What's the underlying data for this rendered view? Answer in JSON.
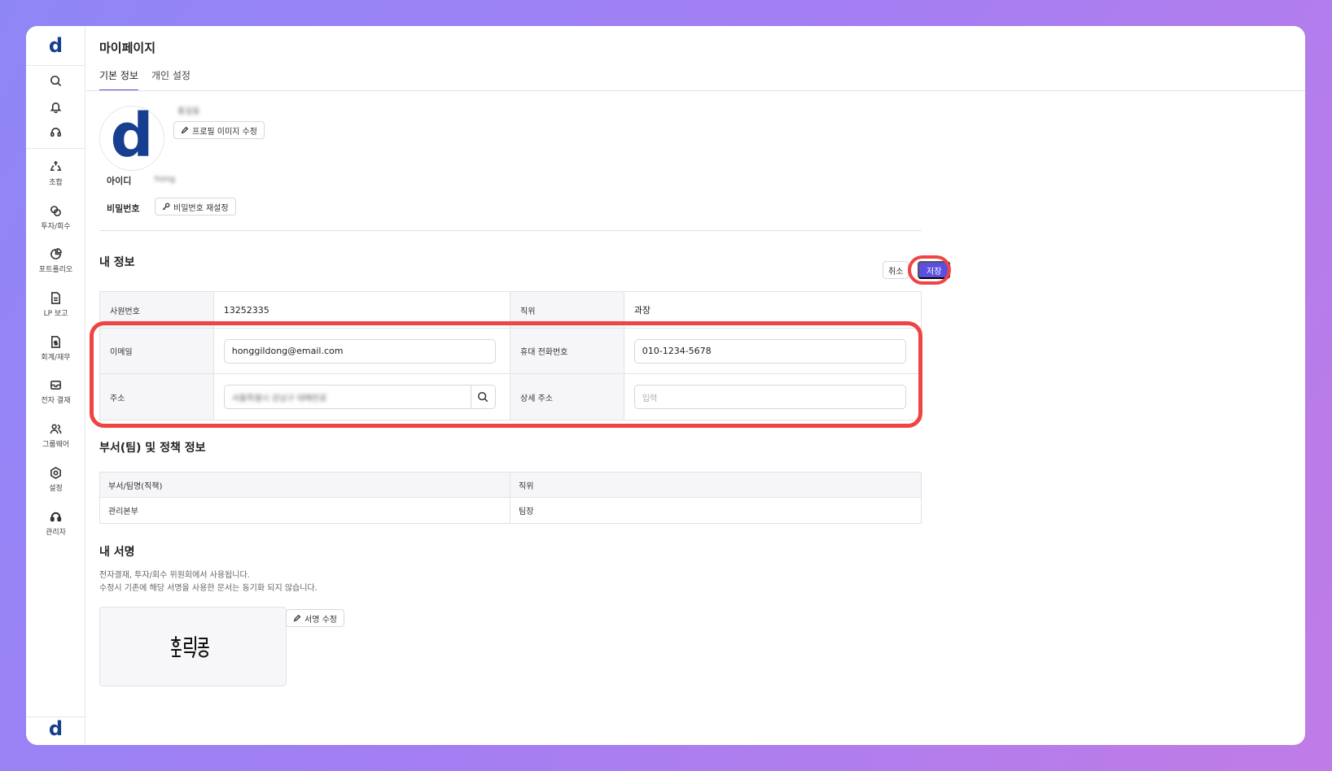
{
  "sidebar": {
    "logo": "d",
    "top_icons": [
      "search-icon",
      "bell-icon",
      "headset-icon"
    ],
    "items": [
      {
        "label": "조합",
        "icon": "recycle-icon"
      },
      {
        "label": "투자/회수",
        "icon": "exchange-icon"
      },
      {
        "label": "포트폴리오",
        "icon": "pie-chart-icon"
      },
      {
        "label": "LP 보고",
        "icon": "document-icon"
      },
      {
        "label": "회계/재무",
        "icon": "finance-doc-icon"
      },
      {
        "label": "전자 결재",
        "icon": "mail-icon"
      },
      {
        "label": "그룹웨어",
        "icon": "users-icon"
      },
      {
        "label": "설정",
        "icon": "gear-icon"
      },
      {
        "label": "관리자",
        "icon": "admin-headset-icon"
      }
    ],
    "bottom_logo": "d"
  },
  "page": {
    "title": "마이페이지",
    "tabs": [
      {
        "label": "기본 정보",
        "active": true
      },
      {
        "label": "개인 설정",
        "active": false
      }
    ]
  },
  "profile": {
    "avatar_letter": "d",
    "username": "홍길동",
    "edit_image_label": "프로필 이미지 수정",
    "id_label": "아이디",
    "id_value": "hong",
    "password_label": "비밀번호",
    "reset_password_label": "비밀번호 재설정"
  },
  "my_info": {
    "title": "내 정보",
    "cancel_label": "취소",
    "save_label": "저장",
    "employee_no_label": "사원번호",
    "employee_no": "13252335",
    "position_label": "직위",
    "position": "과장",
    "email_label": "이메일",
    "email": "honggildong@email.com",
    "phone_label": "휴대 전화번호",
    "phone": "010-1234-5678",
    "address_label": "주소",
    "address": "서울특별시 강남구 테헤란로",
    "detail_address_label": "상세 주소",
    "detail_address_placeholder": "입력"
  },
  "dept": {
    "title": "부서(팀) 및 정책 정보",
    "headers": [
      "부서/팀명(직책)",
      "직위"
    ],
    "rows": [
      [
        "관리본부",
        "팀장"
      ]
    ]
  },
  "signature": {
    "title": "내 서명",
    "desc1": "전자결재, 투자/회수 위원회에서 사용됩니다.",
    "desc2": "수정시 기존에 해당 서명을 사용한 문서는 동기화 되지 않습니다.",
    "edit_label": "서명 수정",
    "signature_text": "홍길동"
  },
  "colors": {
    "accent": "#5b4fe0",
    "logo": "#163f8f",
    "highlight": "#f04444"
  }
}
